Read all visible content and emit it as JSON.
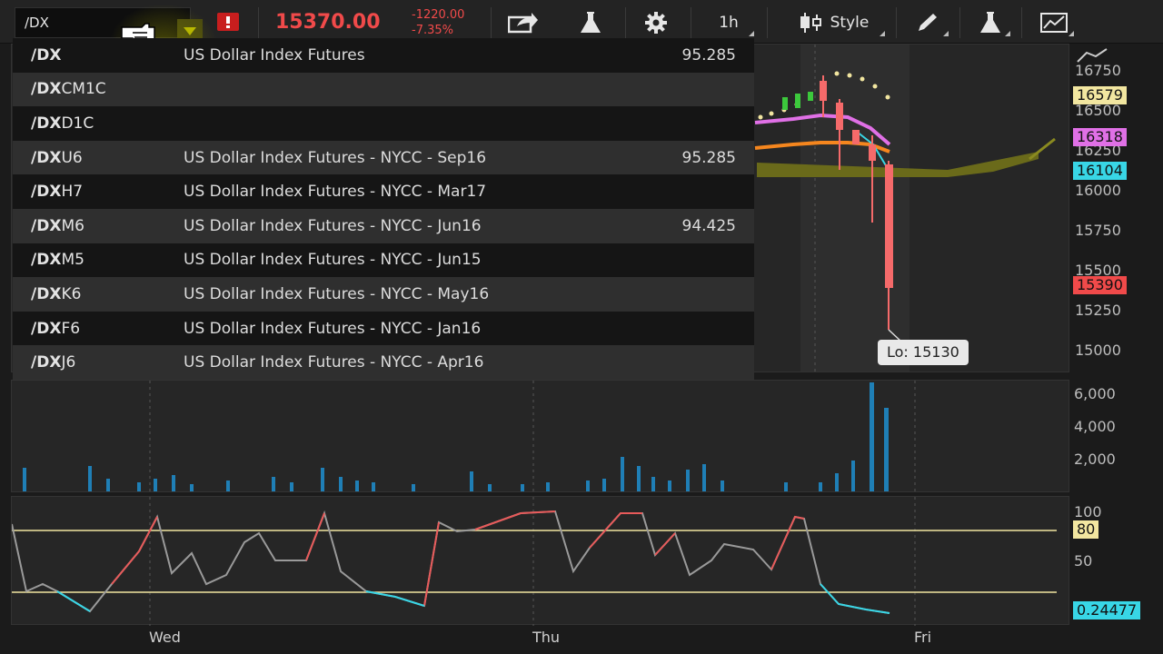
{
  "toolbar": {
    "symbol": "/DX",
    "last_price": "15370.00",
    "net_change": "-1220.00",
    "percent_change": "-7.35%",
    "timeframe_label": "1h",
    "style_label": "Style",
    "icons": [
      "share-icon",
      "flask-icon",
      "gear-icon",
      "candlestick-icon",
      "pencil-icon",
      "studies-flask-icon",
      "active-trader-icon"
    ],
    "colors": {
      "down": "#f04a4a",
      "background": "#232323"
    }
  },
  "dropdown": {
    "items": [
      {
        "root": "/DX",
        "suffix": "",
        "description": "US Dollar Index Futures",
        "price": "95.285"
      },
      {
        "root": "/DX",
        "suffix": "CM1C",
        "description": "",
        "price": ""
      },
      {
        "root": "/DX",
        "suffix": "D1C",
        "description": "",
        "price": ""
      },
      {
        "root": "/DX",
        "suffix": "U6",
        "description": "US Dollar Index Futures - NYCC - Sep16",
        "price": "95.285"
      },
      {
        "root": "/DX",
        "suffix": "H7",
        "description": "US Dollar Index Futures - NYCC - Mar17",
        "price": ""
      },
      {
        "root": "/DX",
        "suffix": "M6",
        "description": "US Dollar Index Futures - NYCC - Jun16",
        "price": "94.425"
      },
      {
        "root": "/DX",
        "suffix": "M5",
        "description": "US Dollar Index Futures - NYCC - Jun15",
        "price": ""
      },
      {
        "root": "/DX",
        "suffix": "K6",
        "description": "US Dollar Index Futures - NYCC - May16",
        "price": ""
      },
      {
        "root": "/DX",
        "suffix": "F6",
        "description": "US Dollar Index Futures - NYCC - Jan16",
        "price": ""
      },
      {
        "root": "/DX",
        "suffix": "J6",
        "description": "US Dollar Index Futures - NYCC - Apr16",
        "price": ""
      }
    ]
  },
  "price_pane": {
    "axis_ticks": [
      "16750",
      "16500",
      "16250",
      "16000",
      "15750",
      "15500",
      "15250",
      "15000"
    ],
    "tags": [
      {
        "value": "16579",
        "color": "#f2e6a0"
      },
      {
        "value": "16318",
        "color": "#e070e6"
      },
      {
        "value": "16104",
        "color": "#38d6e6"
      },
      {
        "value": "15390",
        "color": "#f04a4a"
      }
    ],
    "low_label": "Lo: 15130"
  },
  "volume_pane": {
    "axis_ticks": [
      "6,000",
      "4,000",
      "2,000"
    ]
  },
  "osc_pane": {
    "axis_ticks": [
      "100",
      "50"
    ],
    "tags": [
      {
        "value": "80",
        "color": "#f2e6a0"
      },
      {
        "value": "0.24477",
        "color": "#38d6e6"
      }
    ]
  },
  "x_axis": {
    "labels": [
      "Wed",
      "Thu",
      "Fri"
    ]
  }
}
